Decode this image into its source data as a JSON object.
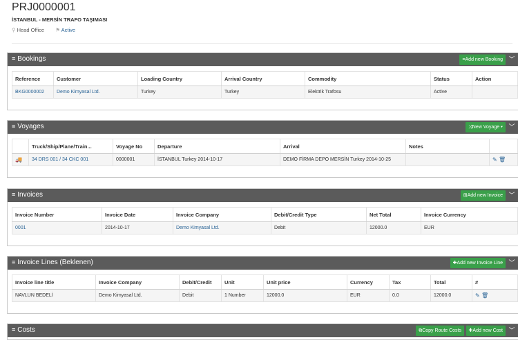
{
  "project": {
    "code": "PRJ0000001",
    "name": "İSTANBUL - MERSİN TRAFO TAŞIMASI",
    "office": "Head Office",
    "status": "Active"
  },
  "bookings": {
    "title": "Bookings",
    "add_button": "Add new Booking",
    "columns": [
      "Reference",
      "Customer",
      "Loading Country",
      "Arrival Country",
      "Commodity",
      "Status",
      "Action"
    ],
    "rows": [
      {
        "reference": "BKG0000002",
        "customer": "Demo Kimyasal Ltd.",
        "loading_country": "Turkey",
        "arrival_country": "Turkey",
        "commodity": "Elektrik Trafosu",
        "status": "Active",
        "action": ""
      }
    ]
  },
  "voyages": {
    "title": "Voyages",
    "add_button": "New Voyage",
    "columns": [
      "",
      "Truck/Ship/Plane/Train...",
      "Voyage No",
      "Departure",
      "Arrival",
      "Notes",
      ""
    ],
    "rows": [
      {
        "vehicle": "34 DRS 001 / 34 CKC 001",
        "voyage_no": "0000001",
        "departure": "İSTANBUL Turkey 2014-10-17",
        "arrival": "DEMO FİRMA DEPO MERSİN Turkey 2014-10-25",
        "notes": ""
      }
    ]
  },
  "invoices": {
    "title": "Invoices",
    "add_button": "Add new Invoice",
    "columns": [
      "Invoice Number",
      "Invoice Date",
      "Invoice Company",
      "Debit/Credit Type",
      "Net Total",
      "Invoice Currency"
    ],
    "rows": [
      {
        "number": "0001",
        "date": "2014-10-17",
        "company": "Demo Kimyasal Ltd.",
        "type": "Debit",
        "net_total": "12000.0",
        "currency": "EUR"
      }
    ]
  },
  "invoice_lines": {
    "title": "Invoice Lines (Beklenen)",
    "add_button": "Add new Invoice Line",
    "columns": [
      "Invoice line title",
      "Invoice Company",
      "Debit/Credit",
      "Unit",
      "Unit price",
      "Currency",
      "Tax",
      "Total",
      "#"
    ],
    "rows": [
      {
        "title": "NAVLUN BEDELİ",
        "company": "Demo Kimyasal Ltd.",
        "debit_credit": "Debit",
        "unit": "1 Number",
        "unit_price": "12000.0",
        "currency": "EUR",
        "tax": "0.0",
        "total": "12000.0"
      }
    ]
  },
  "costs": {
    "title": "Costs",
    "copy_button": "Copy Route Costs",
    "add_button": "Add new Cost"
  }
}
